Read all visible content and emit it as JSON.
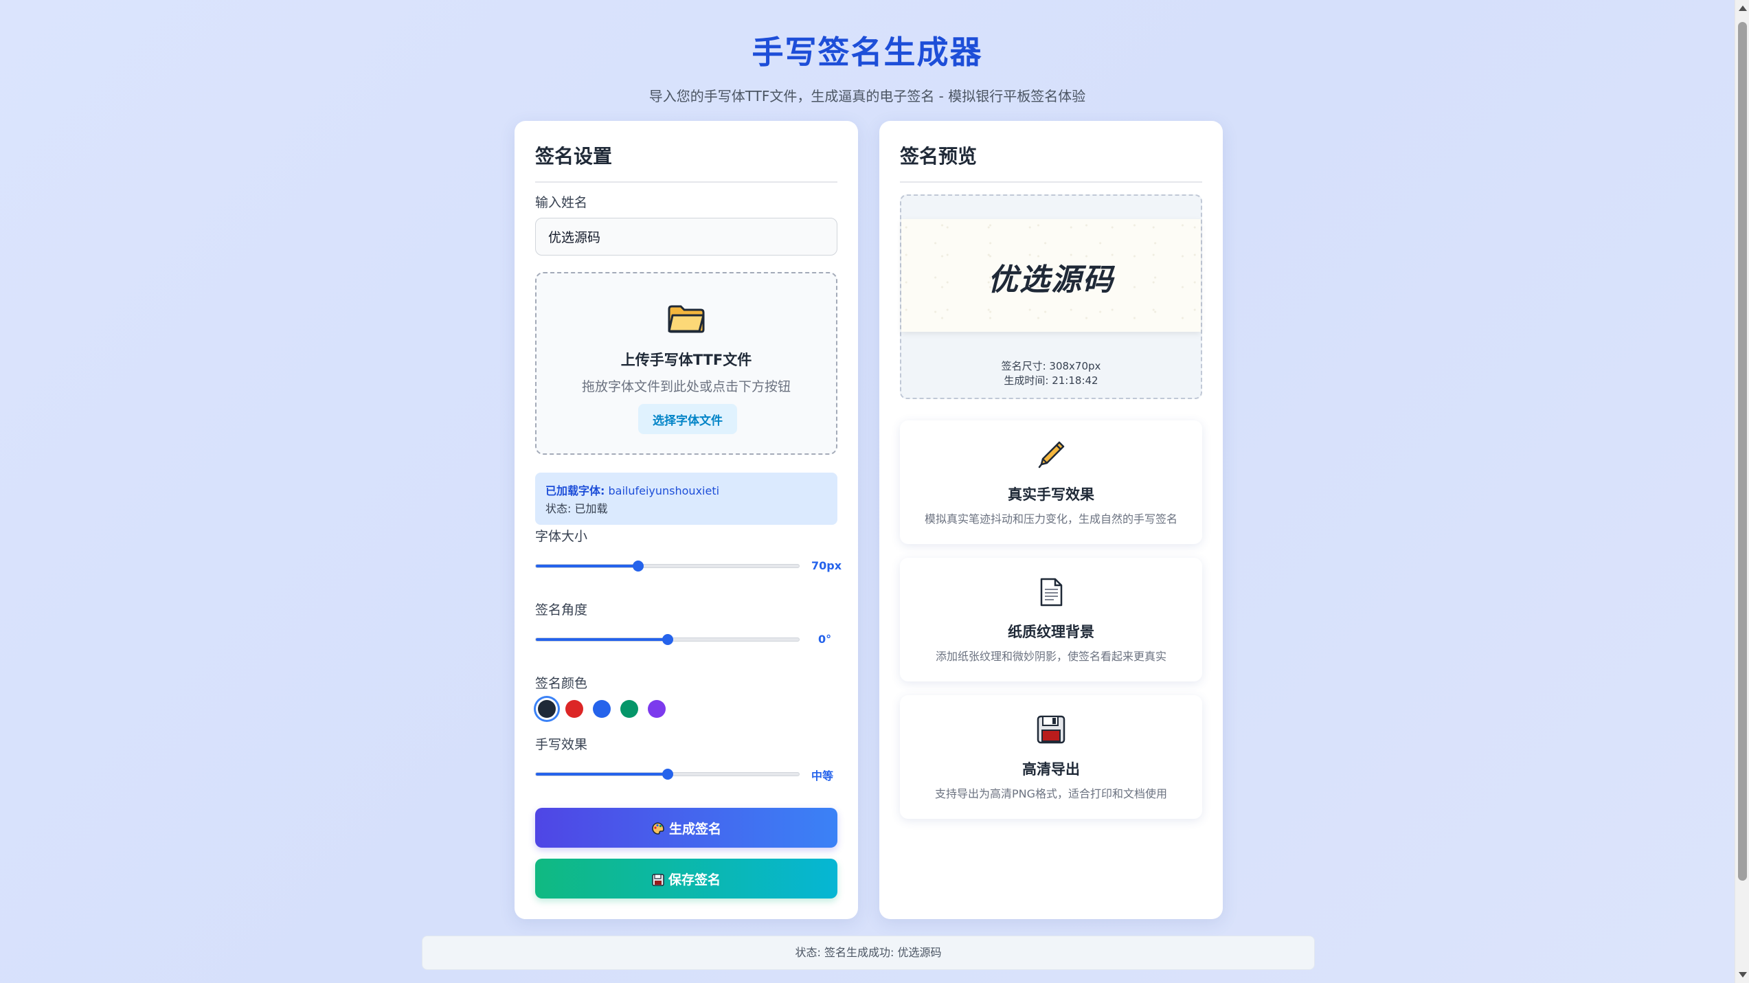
{
  "header": {
    "title": "手写签名生成器",
    "subtitle": "导入您的手写体TTF文件，生成逼真的电子签名 - 模拟银行平板签名体验"
  },
  "settings": {
    "title": "签名设置",
    "name_label": "输入姓名",
    "name_value": "优选源码",
    "upload": {
      "icon": "folder-icon",
      "title": "上传手写体TTF文件",
      "hint": "拖放字体文件到此处或点击下方按钮",
      "button": "选择字体文件"
    },
    "font_info": {
      "loaded_label": "已加载字体:",
      "font_name": "bailufeiyunshouxieti",
      "status": "状态: 已加载"
    },
    "font_size": {
      "label": "字体大小",
      "value": "70px",
      "fraction": 0.39
    },
    "angle": {
      "label": "签名角度",
      "value": "0°",
      "fraction": 0.5
    },
    "color": {
      "label": "签名颜色",
      "options": [
        "#1f2937",
        "#dc2626",
        "#2563eb",
        "#059669",
        "#7c3aed"
      ],
      "selected": 0
    },
    "effect": {
      "label": "手写效果",
      "value": "中等",
      "fraction": 0.5
    },
    "generate_button": "生成签名",
    "save_button": "保存签名"
  },
  "preview": {
    "title": "签名预览",
    "signature_text": "优选源码",
    "size_text": "签名尺寸: 308x70px",
    "time_text": "生成时间: 21:18:42"
  },
  "features": [
    {
      "icon": "pen-icon",
      "title": "真实手写效果",
      "desc": "模拟真实笔迹抖动和压力变化，生成自然的手写签名"
    },
    {
      "icon": "document-icon",
      "title": "纸质纹理背景",
      "desc": "添加纸张纹理和微妙阴影，使签名看起来更真实"
    },
    {
      "icon": "floppy-disk-icon",
      "title": "高清导出",
      "desc": "支持导出为高清PNG格式，适合打印和文档使用"
    }
  ],
  "status": "状态: 签名生成成功: 优选源码",
  "colors": {
    "accent": "#2563eb",
    "title": "#1d4ed8",
    "generate_gradient": [
      "#4f46e5",
      "#3b82f6"
    ],
    "save_gradient": [
      "#10b981",
      "#06b6d4"
    ]
  }
}
